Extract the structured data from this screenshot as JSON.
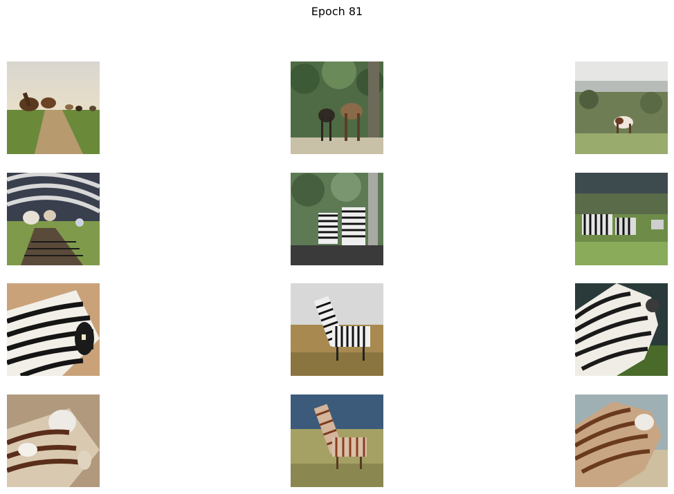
{
  "figure": {
    "title": "Epoch 81"
  },
  "grid": {
    "rows": 4,
    "cols": 3,
    "cells": [
      [
        "horses-on-dirt-road-photo",
        "two-horses-in-forest-photo",
        "pinto-horse-by-coast-photo"
      ],
      [
        "generated-zebras-on-road-image",
        "generated-zebras-in-forest-image",
        "generated-zebras-on-grass-image"
      ],
      [
        "zebra-head-closeup-photo",
        "two-zebras-on-savanna-photo",
        "zebra-neck-profile-photo"
      ],
      [
        "generated-brown-horse-closeup-image",
        "generated-brown-horses-on-savanna-image",
        "generated-brown-horse-profile-image"
      ]
    ]
  }
}
